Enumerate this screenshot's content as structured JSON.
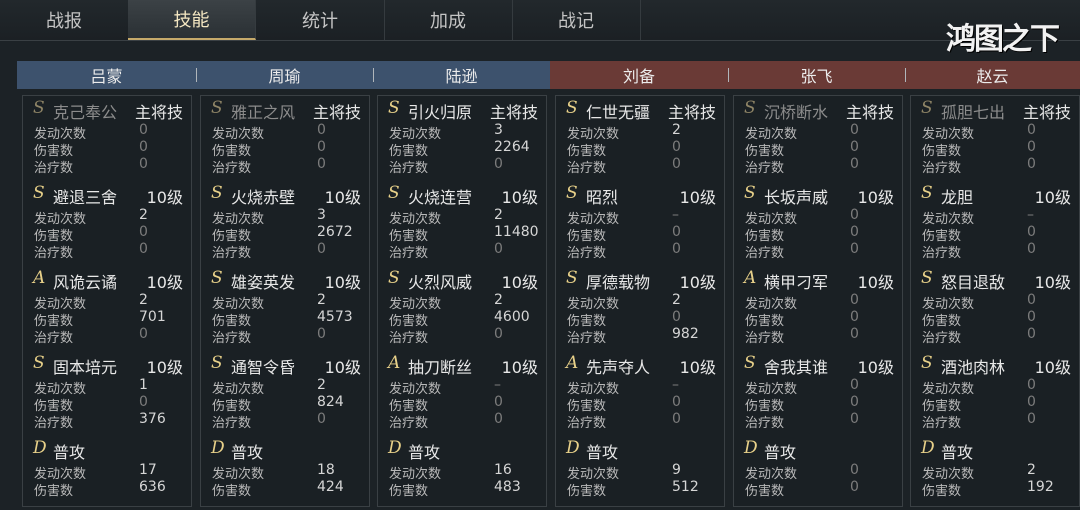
{
  "tabs": [
    {
      "label": "战报",
      "active": false
    },
    {
      "label": "技能",
      "active": true
    },
    {
      "label": "统计",
      "active": false
    },
    {
      "label": "加成",
      "active": false
    },
    {
      "label": "战记",
      "active": false
    }
  ],
  "logo": "鸿图之下",
  "heroes": [
    {
      "name": "吕蒙",
      "side": "blue"
    },
    {
      "name": "周瑜",
      "side": "blue"
    },
    {
      "name": "陆逊",
      "side": "blue"
    },
    {
      "name": "刘备",
      "side": "red"
    },
    {
      "name": "张飞",
      "side": "red"
    },
    {
      "name": "赵云",
      "side": "red"
    }
  ],
  "labels": {
    "trigger": "发动次数",
    "damage": "伤害数",
    "heal": "治疗数"
  },
  "panels": [
    {
      "skills": [
        {
          "grade": "S",
          "name": "克己奉公",
          "level": "主将技",
          "dim": true,
          "trigger": "0",
          "damage": "0",
          "heal": "0"
        },
        {
          "grade": "S",
          "name": "避退三舍",
          "level": "10级",
          "trigger": "2",
          "damage": "0",
          "heal": "0"
        },
        {
          "grade": "A",
          "name": "风诡云谲",
          "level": "10级",
          "trigger": "2",
          "damage": "701",
          "heal": "0"
        },
        {
          "grade": "S",
          "name": "固本培元",
          "level": "10级",
          "trigger": "1",
          "damage": "0",
          "heal": "376"
        },
        {
          "grade": "D",
          "name": "普攻",
          "level": "",
          "trigger": "17",
          "damage": "636"
        }
      ]
    },
    {
      "skills": [
        {
          "grade": "S",
          "name": "雅正之风",
          "level": "主将技",
          "dim": true,
          "trigger": "0",
          "damage": "0",
          "heal": "0"
        },
        {
          "grade": "S",
          "name": "火烧赤壁",
          "level": "10级",
          "trigger": "3",
          "damage": "2672",
          "heal": "0"
        },
        {
          "grade": "S",
          "name": "雄姿英发",
          "level": "10级",
          "trigger": "2",
          "damage": "4573",
          "heal": "0"
        },
        {
          "grade": "S",
          "name": "通智令昏",
          "level": "10级",
          "trigger": "2",
          "damage": "824",
          "heal": "0"
        },
        {
          "grade": "D",
          "name": "普攻",
          "level": "",
          "trigger": "18",
          "damage": "424"
        }
      ]
    },
    {
      "skills": [
        {
          "grade": "S",
          "name": "引火归原",
          "level": "主将技",
          "trigger": "3",
          "damage": "2264",
          "heal": "0"
        },
        {
          "grade": "S",
          "name": "火烧连营",
          "level": "10级",
          "trigger": "2",
          "damage": "11480",
          "heal": "0"
        },
        {
          "grade": "S",
          "name": "火烈风威",
          "level": "10级",
          "trigger": "2",
          "damage": "4600",
          "heal": "0"
        },
        {
          "grade": "A",
          "name": "抽刀断丝",
          "level": "10级",
          "trigger": "–",
          "damage": "0",
          "heal": "0"
        },
        {
          "grade": "D",
          "name": "普攻",
          "level": "",
          "trigger": "16",
          "damage": "483"
        }
      ]
    },
    {
      "skills": [
        {
          "grade": "S",
          "name": "仁世无疆",
          "level": "主将技",
          "trigger": "2",
          "damage": "0",
          "heal": "0"
        },
        {
          "grade": "S",
          "name": "昭烈",
          "level": "10级",
          "trigger": "–",
          "damage": "0",
          "heal": "0"
        },
        {
          "grade": "S",
          "name": "厚德载物",
          "level": "10级",
          "trigger": "2",
          "damage": "0",
          "heal": "982"
        },
        {
          "grade": "A",
          "name": "先声夺人",
          "level": "10级",
          "trigger": "–",
          "damage": "0",
          "heal": "0"
        },
        {
          "grade": "D",
          "name": "普攻",
          "level": "",
          "trigger": "9",
          "damage": "512"
        }
      ]
    },
    {
      "skills": [
        {
          "grade": "S",
          "name": "沉桥断水",
          "level": "主将技",
          "dim": true,
          "trigger": "0",
          "damage": "0",
          "heal": "0"
        },
        {
          "grade": "S",
          "name": "长坂声威",
          "level": "10级",
          "trigger": "0",
          "damage": "0",
          "heal": "0"
        },
        {
          "grade": "A",
          "name": "横甲刁军",
          "level": "10级",
          "trigger": "0",
          "damage": "0",
          "heal": "0"
        },
        {
          "grade": "S",
          "name": "舍我其谁",
          "level": "10级",
          "trigger": "0",
          "damage": "0",
          "heal": "0"
        },
        {
          "grade": "D",
          "name": "普攻",
          "level": "",
          "trigger": "0",
          "damage": "0"
        }
      ]
    },
    {
      "skills": [
        {
          "grade": "S",
          "name": "孤胆七出",
          "level": "主将技",
          "dim": true,
          "trigger": "0",
          "damage": "0",
          "heal": "0"
        },
        {
          "grade": "S",
          "name": "龙胆",
          "level": "10级",
          "trigger": "–",
          "damage": "0",
          "heal": "0"
        },
        {
          "grade": "S",
          "name": "怒目退敌",
          "level": "10级",
          "trigger": "0",
          "damage": "0",
          "heal": "0"
        },
        {
          "grade": "S",
          "name": "酒池肉林",
          "level": "10级",
          "trigger": "0",
          "damage": "0",
          "heal": "0"
        },
        {
          "grade": "D",
          "name": "普攻",
          "level": "",
          "trigger": "2",
          "damage": "192"
        }
      ]
    }
  ]
}
